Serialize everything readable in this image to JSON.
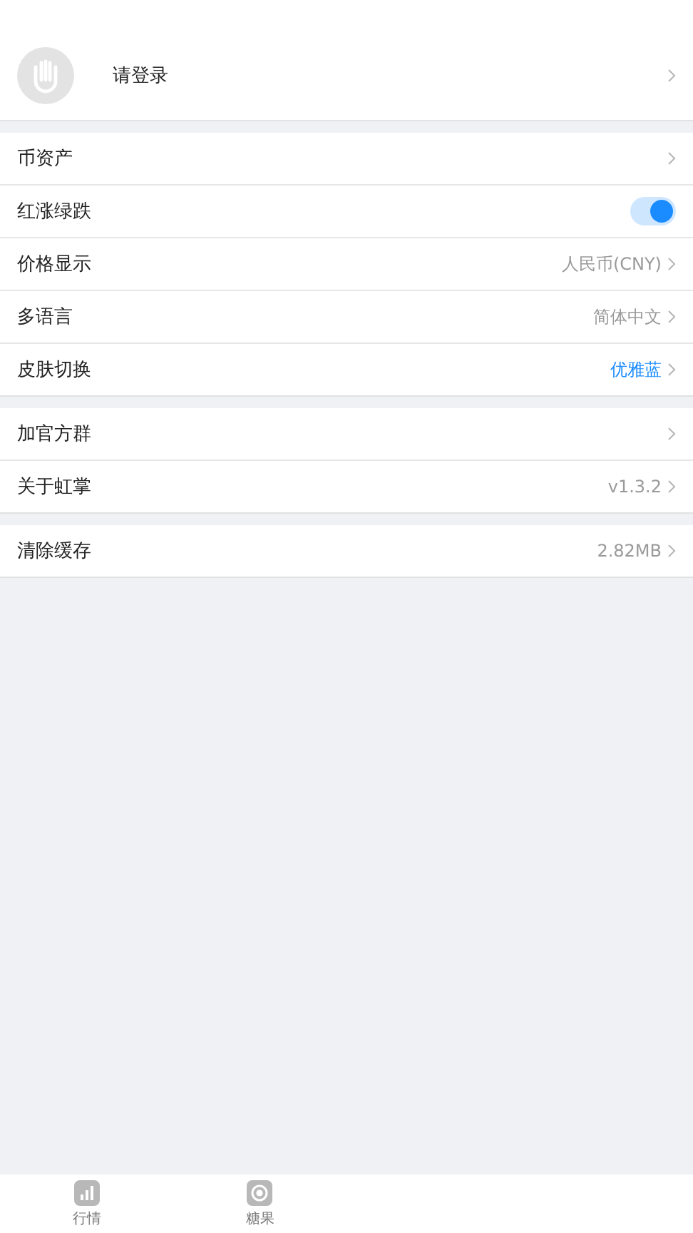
{
  "login": {
    "label": "请登录"
  },
  "groups": [
    {
      "items": [
        {
          "kind": "link",
          "label": "币资产"
        },
        {
          "kind": "toggle",
          "label": "红涨绿跌",
          "on": true
        },
        {
          "kind": "link",
          "label": "价格显示",
          "value": "人民币(CNY)",
          "color": "#9a9a9a"
        },
        {
          "kind": "link",
          "label": "多语言",
          "value": "简体中文",
          "color": "#9a9a9a"
        },
        {
          "kind": "link",
          "label": "皮肤切换",
          "value": "优雅蓝",
          "color": "#1a8cff"
        }
      ]
    },
    {
      "items": [
        {
          "kind": "link",
          "label": "加官方群"
        },
        {
          "kind": "link",
          "label": "关于虹掌",
          "value": "v1.3.2",
          "color": "#9a9a9a"
        }
      ]
    },
    {
      "items": [
        {
          "kind": "link",
          "label": "清除缓存",
          "value": "2.82MB",
          "color": "#9a9a9a"
        }
      ]
    }
  ],
  "tab_bar": [
    {
      "kind": "chart",
      "label": "行情",
      "selected": false
    },
    {
      "kind": "candy",
      "label": "糖果",
      "selected": false
    }
  ]
}
